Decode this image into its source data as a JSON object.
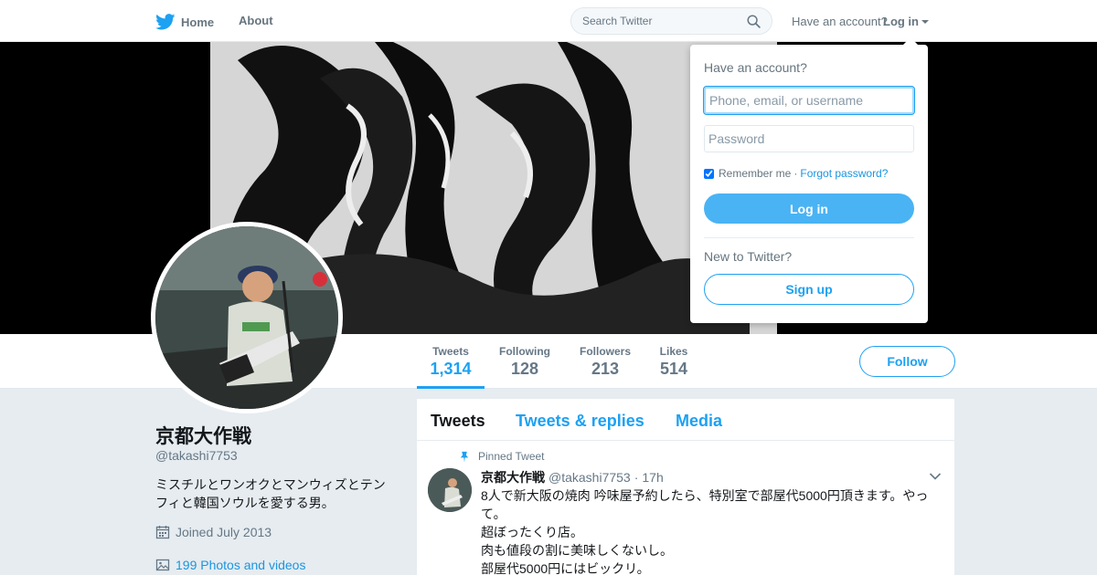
{
  "nav": {
    "home_label": "Home",
    "about_label": "About",
    "search_placeholder": "Search Twitter",
    "account_prompt": "Have an account?",
    "login_label": "Log in"
  },
  "stats": {
    "tweets_label": "Tweets",
    "tweets_value": "1,314",
    "following_label": "Following",
    "following_value": "128",
    "followers_label": "Followers",
    "followers_value": "213",
    "likes_label": "Likes",
    "likes_value": "514"
  },
  "follow_label": "Follow",
  "profile": {
    "name": "京都大作戦",
    "handle": "@takashi7753",
    "bio": "ミスチルとワンオクとマンウィズとテンフィと韓国ソウルを愛する男。",
    "joined": "Joined July 2013",
    "photos": "199 Photos and videos"
  },
  "timeline": {
    "tabs": [
      "Tweets",
      "Tweets & replies",
      "Media"
    ],
    "tweet": {
      "pinned_label": "Pinned Tweet",
      "author": "京都大作戦",
      "handle": "@takashi7753",
      "separator": "·",
      "time": "17h",
      "lines": [
        "8人で新大阪の焼肉 吟味屋予約したら、特別室で部屋代5000円頂きます。やって。",
        "超ぼったくり店。",
        "肉も値段の割に美味しくないし。",
        "部屋代5000円にはビックリ。"
      ]
    }
  },
  "login_dropdown": {
    "title": "Have an account?",
    "username_placeholder": "Phone, email, or username",
    "password_placeholder": "Password",
    "remember_label": "Remember me",
    "separator": "·",
    "forgot_label": "Forgot password?",
    "login_button": "Log in",
    "new_prompt": "New to Twitter?",
    "signup_button": "Sign up"
  },
  "colors": {
    "accent": "#1da1f2",
    "login_button": "#4ab3f4",
    "background": "#e6ecf0"
  },
  "icons": [
    "twitter-bird-icon",
    "search-icon",
    "caret-down-icon",
    "calendar-icon",
    "photo-icon",
    "pin-icon",
    "chevron-down-icon"
  ]
}
